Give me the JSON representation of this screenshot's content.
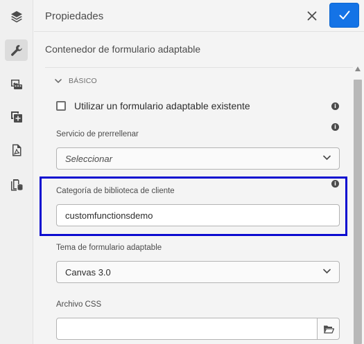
{
  "rail": {
    "items": [
      {
        "icon": "layers-icon"
      },
      {
        "icon": "wrench-icon",
        "active": true
      },
      {
        "icon": "assets-icon"
      },
      {
        "icon": "add-component-icon"
      },
      {
        "icon": "pdf-icon"
      },
      {
        "icon": "data-sources-icon"
      }
    ]
  },
  "header": {
    "title": "Propiedades",
    "close_icon": "close-icon",
    "confirm_icon": "check-icon",
    "accent": "#1473e6"
  },
  "component_name": "Contenedor de formulario adaptable",
  "section": {
    "label": "BÁSICO"
  },
  "checkbox": {
    "label": "Utilizar un formulario adaptable existente",
    "checked": false
  },
  "prefill": {
    "label": "Servicio de prerrellenar",
    "value": "Seleccionar"
  },
  "client_lib": {
    "label": "Categoría de biblioteca de cliente",
    "value": "customfunctionsdemo",
    "highlight_color": "#0b0bd0"
  },
  "theme": {
    "label": "Tema de formulario adaptable",
    "value": "Canvas 3.0"
  },
  "css_file": {
    "label": "Archivo CSS",
    "value": ""
  },
  "info_glyph": "i"
}
